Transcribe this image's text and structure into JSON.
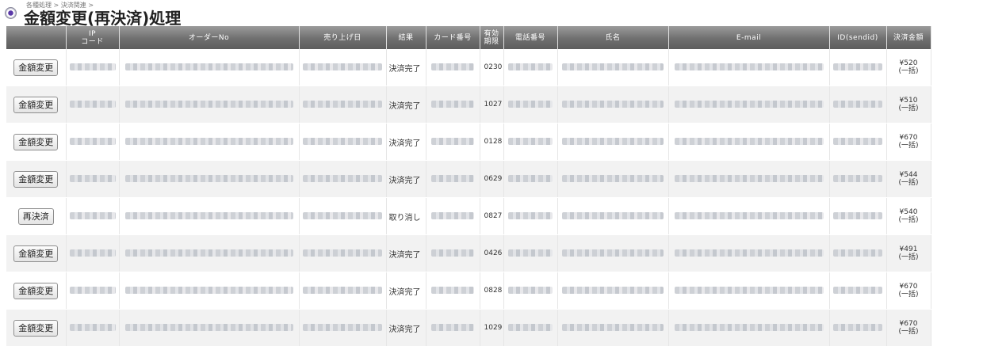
{
  "breadcrumb": [
    "各種処理",
    "決済関連"
  ],
  "breadcrumb_separator": ">",
  "page_title": "金額変更(再決済)処理",
  "columns": {
    "action": "",
    "ip_code": "IP\nコード",
    "order_no": "オーダーNo",
    "sale_date": "売り上げ日",
    "result": "結果",
    "card_no": "カード番号",
    "expiry": "有効\n期限",
    "phone": "電話番号",
    "name": "氏名",
    "email": "E-mail",
    "sendid": "ID(sendid)",
    "amount": "決済金額"
  },
  "rows": [
    {
      "action": "金額変更",
      "result": "決済完了",
      "expiry": "0230",
      "amount": "¥520",
      "method": "(一括)"
    },
    {
      "action": "金額変更",
      "result": "決済完了",
      "expiry": "1027",
      "amount": "¥510",
      "method": "(一括)"
    },
    {
      "action": "金額変更",
      "result": "決済完了",
      "expiry": "0128",
      "amount": "¥670",
      "method": "(一括)"
    },
    {
      "action": "金額変更",
      "result": "決済完了",
      "expiry": "0629",
      "amount": "¥544",
      "method": "(一括)"
    },
    {
      "action": "再決済",
      "result": "取り消し",
      "expiry": "0827",
      "amount": "¥540",
      "method": "(一括)"
    },
    {
      "action": "金額変更",
      "result": "決済完了",
      "expiry": "0426",
      "amount": "¥491",
      "method": "(一括)"
    },
    {
      "action": "金額変更",
      "result": "決済完了",
      "expiry": "0828",
      "amount": "¥670",
      "method": "(一括)"
    },
    {
      "action": "金額変更",
      "result": "決済完了",
      "expiry": "1029",
      "amount": "¥670",
      "method": "(一括)"
    }
  ],
  "colors": {
    "header_bg": "#7a7a7a",
    "row_alt": "#f2f2f2",
    "accent_icon": "#5a38a8"
  }
}
